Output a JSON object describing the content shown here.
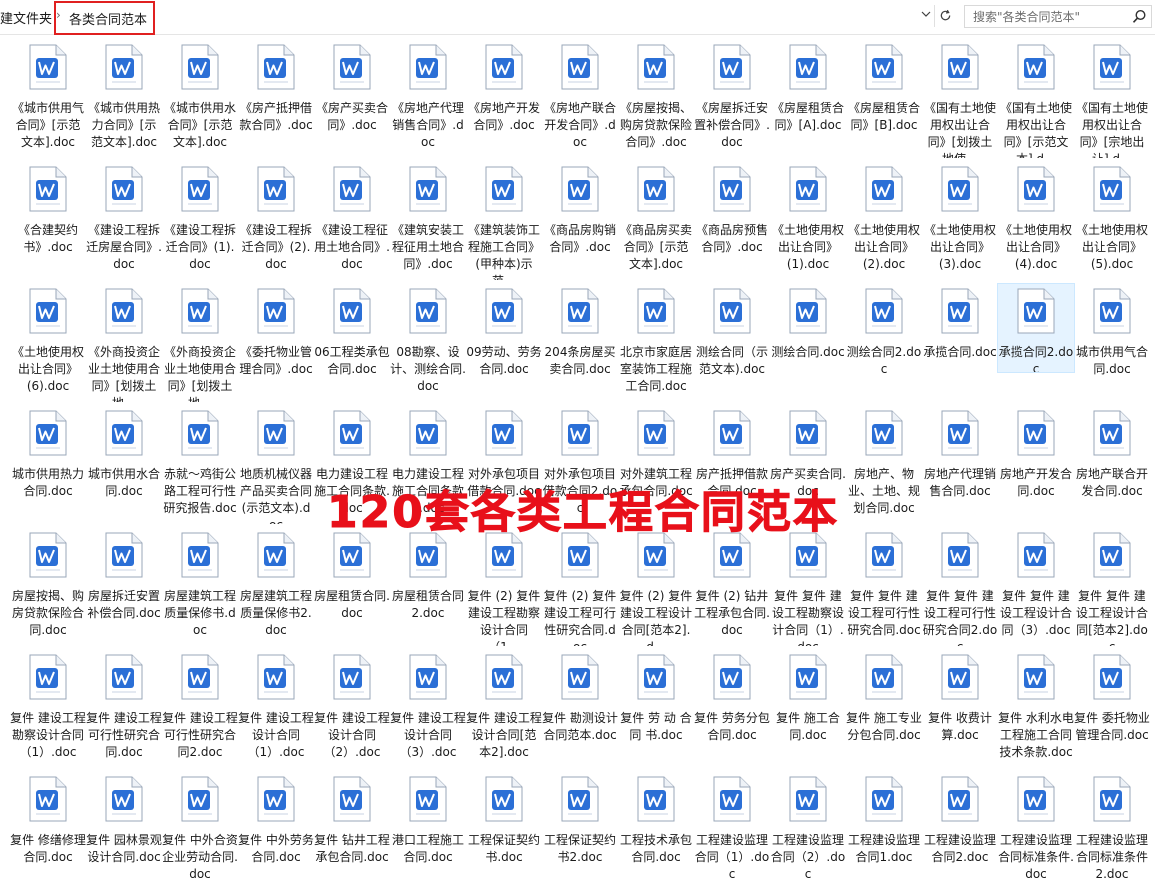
{
  "address_bar": {
    "parent_crumb": "建文件夹",
    "separator": "›",
    "current_folder": "各类合同范本",
    "dropdown_icon": "chevron-down-icon",
    "refresh_icon": "refresh-icon"
  },
  "search": {
    "placeholder": "搜索\"各类合同范本\"",
    "icon": "search-icon"
  },
  "overlay_text": "120套各类工程合同范本",
  "colors": {
    "highlight_border": "#e02020",
    "overlay_text": "#e8101a",
    "doc_icon_blue": "#2b6fd6",
    "selection": "#e5f3ff"
  },
  "files": [
    "《城市供用气合同》[示范文本].doc",
    "《城市供用热力合同》[示范文本].doc",
    "《城市供用水合同》[示范文本].doc",
    "《房产抵押借款合同》.doc",
    "《房产买卖合同》.doc",
    "《房地产代理销售合同》.doc",
    "《房地产开发合同》.doc",
    "《房地产联合开发合同》.doc",
    "《房屋按揭、购房贷款保险合同》.doc",
    "《房屋拆迁安置补偿合同》.doc",
    "《房屋租赁合同》[A].doc",
    "《房屋租赁合同》[B].doc",
    "《国有土地使用权出让合同》[划拨土地使…",
    "《国有土地使用权出让合同》[示范文本].d…",
    "《国有土地使用权出让合同》[宗地出让].d…",
    "《合建契约书》.doc",
    "《建设工程拆迁房屋合同》.doc",
    "《建设工程拆迁合同》(1).doc",
    "《建设工程拆迁合同》(2).doc",
    "《建设工程征用土地合同》.doc",
    "《建筑安装工程征用土地合同》.doc",
    "《建筑装饰工程施工合同》(甲种本)示范…",
    "《商品房购销合同》.doc",
    "《商品房买卖合同》[示范文本].doc",
    "《商品房预售合同》.doc",
    "《土地使用权出让合同》(1).doc",
    "《土地使用权出让合同》(2).doc",
    "《土地使用权出让合同》(3).doc",
    "《土地使用权出让合同》(4).doc",
    "《土地使用权出让合同》(5).doc",
    "《土地使用权出让合同》(6).doc",
    "《外商投资企业土地使用合同》[划拨土地…",
    "《外商投资企业土地使用合同》[划拨土地…",
    "《委托物业管理合同》.doc",
    "06工程类承包合同.doc",
    "08勘察、设计、测绘合同.doc",
    "09劳动、劳务合同.doc",
    "204条房屋买卖合同.doc",
    "北京市家庭居室装饰工程施工合同.doc",
    "测绘合同（示范文本).doc",
    "测绘合同.doc",
    "测绘合同2.doc",
    "承揽合同.doc",
    "承揽合同2.doc",
    "城市供用气合同.doc",
    "城市供用热力合同.doc",
    "城市供用水合同.doc",
    "赤就～鸡街公路工程可行性研究报告.doc",
    "地质机械仪器产品买卖合同(示范文本).doc",
    "电力建设工程施工合同条款.doc",
    "电力建设工程施工合同条款2.doc",
    "对外承包项目借款合同.doc",
    "对外承包项目借款合同2.doc",
    "对外建筑工程承包合同.doc",
    "房产抵押借款合同.doc",
    "房产买卖合同.doc",
    "房地产、物业、土地、规划合同.doc",
    "房地产代理销售合同.doc",
    "房地产开发合同.doc",
    "房地产联合开发合同.doc",
    "房屋按揭、购房贷款保险合同.doc",
    "房屋拆迁安置补偿合同.doc",
    "房屋建筑工程质量保修书.doc",
    "房屋建筑工程质量保修书2.doc",
    "房屋租赁合同.doc",
    "房屋租赁合同2.doc",
    "复件 (2) 复件 建设工程勘察设计合同（1…",
    "复件 (2) 复件 建设工程可行性研究合同.doc",
    "复件 (2) 复件 建设工程设计合同[范本2].d…",
    "复件 (2) 钻井工程承包合同.doc",
    "复件 复件 建设工程勘察设计合同（1）.doc",
    "复件 复件 建设工程可行性研究合同.doc",
    "复件 复件 建设工程可行性研究合同2.doc",
    "复件 复件 建设工程设计合同（3）.doc",
    "复件 复件 建设工程设计合同[范本2].doc",
    "复件 建设工程勘察设计合同（1）.doc",
    "复件 建设工程可行性研究合同.doc",
    "复件 建设工程可行性研究合同2.doc",
    "复件 建设工程设计合同（1）.doc",
    "复件 建设工程设计合同（2）.doc",
    "复件 建设工程设计合同（3）.doc",
    "复件 建设工程设计合同[范本2].doc",
    "复件 勘测设计合同范本.doc",
    "复件 劳 动 合 同 书.doc",
    "复件 劳务分包合同.doc",
    "复件 施工合同.doc",
    "复件 施工专业分包合同.doc",
    "复件 收费计算.doc",
    "复件 水利水电工程施工合同技术条款.doc",
    "复件 委托物业管理合同.doc",
    "复件 修缮修理合同.doc",
    "复件 园林景观设计合同.doc",
    "复件 中外合资企业劳动合同.doc",
    "复件 中外劳务合同.doc",
    "复件 钻井工程承包合同.doc",
    "港口工程施工合同.doc",
    "工程保证契约书.doc",
    "工程保证契约书2.doc",
    "工程技术承包合同.doc",
    "工程建设监理合同（1）.doc",
    "工程建设监理合同（2）.doc",
    "工程建设监理合同1.doc",
    "工程建设监理合同2.doc",
    "工程建设监理合同标准条件.doc",
    "工程建设监理合同标准条件2.doc"
  ]
}
